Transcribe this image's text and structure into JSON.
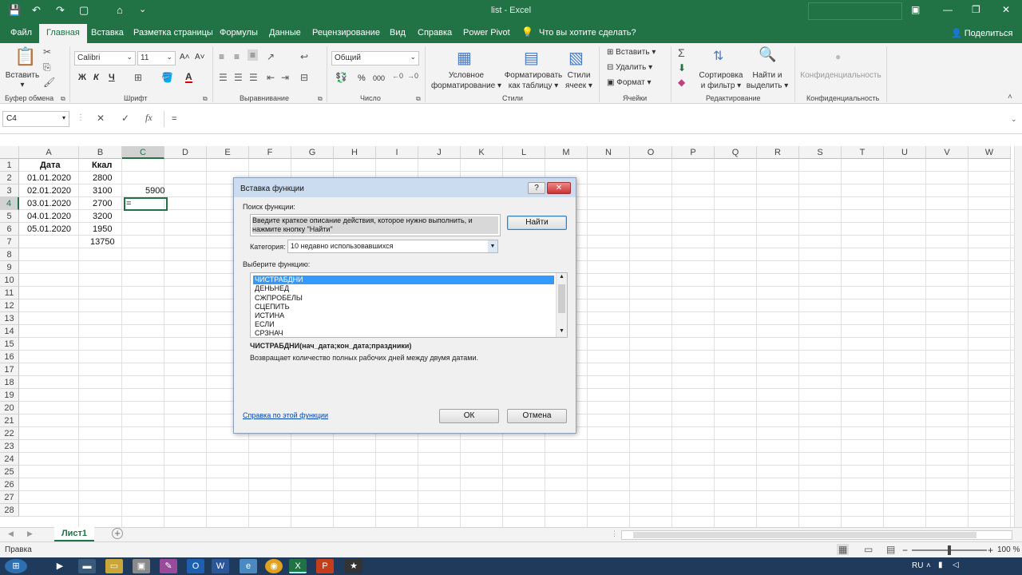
{
  "window": {
    "title": "list - Excel",
    "colors": {
      "accent": "#217346",
      "dialog_title": "#cbdcf0",
      "selection": "#3399ff"
    }
  },
  "quick_access": {
    "save_icon": "save-icon",
    "undo_icon": "undo-icon",
    "redo_icon": "redo-icon",
    "new_icon": "new-file-icon",
    "camera_icon": "camera-icon",
    "more": "⌄"
  },
  "tabs": [
    {
      "label": "Файл"
    },
    {
      "label": "Главная"
    },
    {
      "label": "Вставка"
    },
    {
      "label": "Разметка страницы"
    },
    {
      "label": "Формулы"
    },
    {
      "label": "Данные"
    },
    {
      "label": "Рецензирование"
    },
    {
      "label": "Вид"
    },
    {
      "label": "Справка"
    },
    {
      "label": "Power Pivot"
    }
  ],
  "tell_me": "Что вы хотите сделать?",
  "share": "Поделиться",
  "ribbon": {
    "clipboard": {
      "paste": "Вставить",
      "group": "Буфер обмена"
    },
    "font": {
      "name": "Calibri",
      "size": "11",
      "bold": "Ж",
      "italic": "К",
      "underline": "Ч",
      "grow": "A˄",
      "shrink": "A˅",
      "group": "Шрифт"
    },
    "alignment": {
      "group": "Выравнивание"
    },
    "number": {
      "format": "Общий",
      "percent": "%",
      "thousands": "000",
      "group": "Число"
    },
    "styles": {
      "conditional_1": "Условное",
      "conditional_2": "форматирование ▾",
      "as_table_1": "Форматировать",
      "as_table_2": "как таблицу ▾",
      "cell_styles_1": "Стили",
      "cell_styles_2": "ячеек ▾",
      "group": "Стили"
    },
    "cells": {
      "insert": "Вставить",
      "delete": "Удалить",
      "format": "Формат",
      "group": "Ячейки"
    },
    "editing": {
      "sort_1": "Сортировка",
      "sort_2": "и фильтр ▾",
      "find_1": "Найти и",
      "find_2": "выделить ▾",
      "group": "Редактирование"
    },
    "sensitivity": {
      "label": "Конфиденциальность",
      "group": "Конфиденциальность"
    }
  },
  "formula_bar": {
    "name_box": "C4",
    "cancel": "✕",
    "enter": "✓",
    "fx": "fx",
    "content": "="
  },
  "columns": [
    "A",
    "B",
    "C",
    "D",
    "E",
    "F",
    "G",
    "H",
    "I",
    "J",
    "K",
    "L",
    "M",
    "N",
    "O",
    "P",
    "Q",
    "R",
    "S",
    "T",
    "U",
    "V",
    "W"
  ],
  "rows": [
    "1",
    "2",
    "3",
    "4",
    "5",
    "6",
    "7",
    "8",
    "9",
    "10",
    "11",
    "12",
    "13",
    "14",
    "15",
    "16",
    "17",
    "18",
    "19",
    "20",
    "21",
    "22",
    "23",
    "24",
    "25",
    "26",
    "27",
    "28"
  ],
  "cells": {
    "a1": "Дата",
    "b1": "Ккал",
    "a2": "01.01.2020",
    "b2": "2800",
    "a3": "02.01.2020",
    "b3": "3100",
    "c3": "5900",
    "a4": "03.01.2020",
    "b4": "2700",
    "c4": "=",
    "a5": "04.01.2020",
    "b5": "3200",
    "a6": "05.01.2020",
    "b6": "1950",
    "b7": "13750"
  },
  "sheet": {
    "tab": "Лист1",
    "add": "+"
  },
  "status": {
    "mode": "Правка",
    "zoom": "100 %",
    "zoom_minus": "−",
    "zoom_plus": "+"
  },
  "taskbar": {
    "lang": "RU"
  },
  "dialog": {
    "title": "Вставка функции",
    "help": "?",
    "close": "✕",
    "search_label": "Поиск функции:",
    "search_text": "Введите краткое описание действия, которое нужно выполнить, и нажмите кнопку \"Найти\"",
    "find_button": "Найти",
    "category_label": "Категория:",
    "category_value": "10 недавно использовавшихся",
    "select_label": "Выберите функцию:",
    "functions": [
      "ЧИСТРАБДНИ",
      "ДЕНЬНЕД",
      "СЖПРОБЕЛЫ",
      "СЦЕПИТЬ",
      "ИСТИНА",
      "ЕСЛИ",
      "СРЗНАЧ"
    ],
    "signature": "ЧИСТРАБДНИ(нач_дата;кон_дата;праздники)",
    "description": "Возвращает количество полных рабочих дней между двумя датами.",
    "help_link": "Справка по этой функции",
    "ok": "ОК",
    "cancel": "Отмена"
  }
}
